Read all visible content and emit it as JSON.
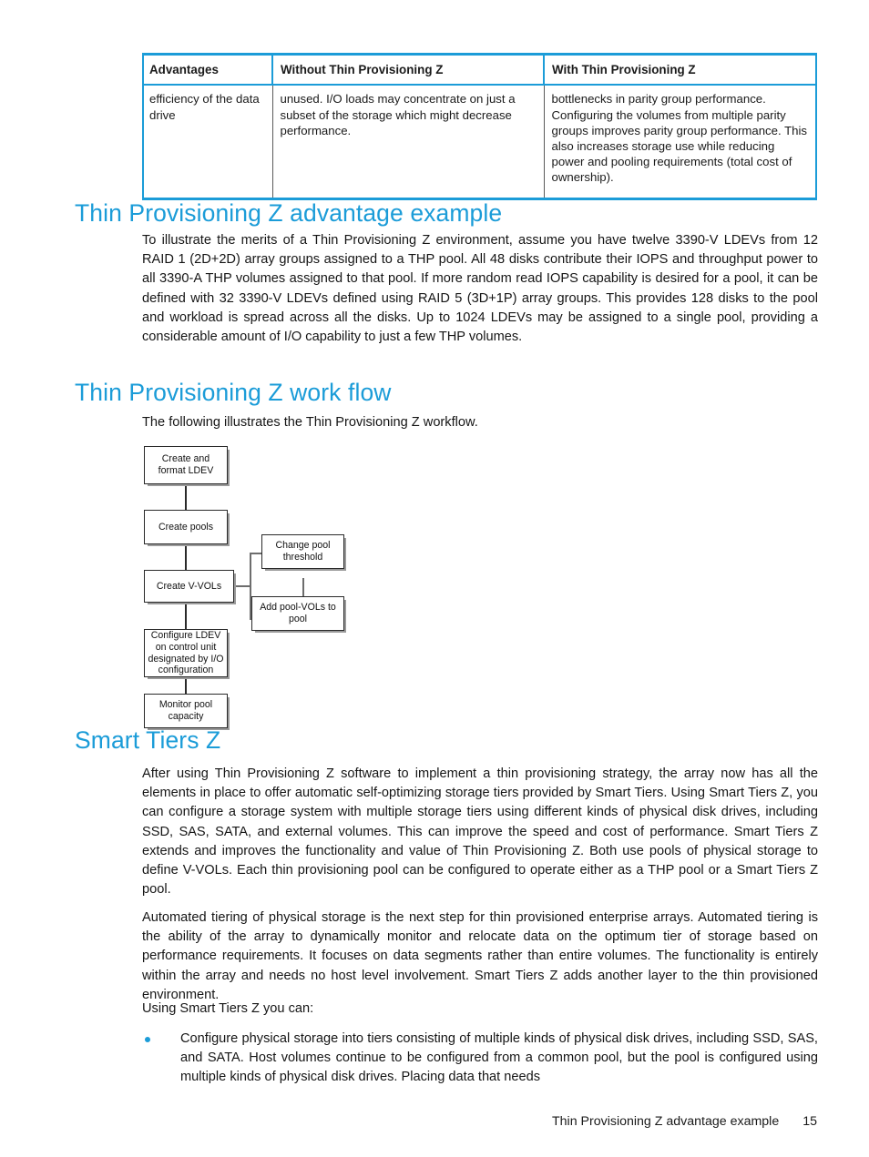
{
  "table": {
    "headers": [
      "Advantages",
      "Without Thin Provisioning Z",
      "With Thin Provisioning Z"
    ],
    "rows": [
      {
        "advantages": "efficiency of the data drive",
        "without": "unused. I/O loads may concentrate on just a subset of the storage which might decrease performance.",
        "with": "bottlenecks in parity group performance. Configuring the volumes from multiple parity groups improves parity group performance. This also increases storage use while reducing power and pooling requirements (total cost of ownership)."
      }
    ]
  },
  "sections": {
    "advantage_example": {
      "heading": "Thin Provisioning Z advantage example",
      "paragraph": "To illustrate the merits of a Thin Provisioning Z environment, assume you have twelve 3390-V LDEVs from 12 RAID 1 (2D+2D) array groups assigned to a THP pool. All 48 disks contribute their IOPS and throughput power to all 3390-A THP volumes assigned to that pool. If more random read IOPS capability is desired for a pool, it can be defined with 32 3390-V LDEVs defined using RAID 5 (3D+1P) array groups. This provides 128 disks to the pool and workload is spread across all the disks. Up to 1024 LDEVs may be assigned to a single pool, providing a considerable amount of I/O capability to just a few THP volumes."
    },
    "work_flow": {
      "heading": "Thin Provisioning Z work flow",
      "paragraph": "The following illustrates the Thin Provisioning Z workflow."
    },
    "smart_tiers": {
      "heading": "Smart Tiers Z",
      "paragraph1": "After using Thin Provisioning Z software to implement a thin provisioning strategy, the array now has all the elements in place to offer automatic self-optimizing storage tiers provided by Smart Tiers. Using Smart Tiers Z, you can configure a storage system with multiple storage tiers using different kinds of physical disk drives, including SSD, SAS, SATA, and external volumes. This can improve the speed and cost of performance. Smart Tiers Z extends and improves the functionality and value of Thin Provisioning Z. Both use pools of physical storage to define V-VOLs. Each thin provisioning pool can be configured to operate either as a THP pool or a Smart Tiers Z pool.",
      "paragraph2": "Automated tiering of physical storage is the next step for thin provisioned enterprise arrays. Automated tiering is the ability of the array to dynamically monitor and relocate data on the optimum tier of storage based on performance requirements. It focuses on data segments rather than entire volumes. The functionality is entirely within the array and needs no host level involvement. Smart Tiers Z adds another layer to the thin provisioned environment.",
      "paragraph3": "Using Smart Tiers Z you can:",
      "bullets": [
        "Configure physical storage into tiers consisting of multiple kinds of physical disk drives, including SSD, SAS, and SATA. Host volumes continue to be configured from a common pool, but the pool is configured using multiple kinds of physical disk drives. Placing data that needs"
      ]
    }
  },
  "diagram": {
    "nodes": [
      {
        "id": "create-format-ldev",
        "label": "Create and format LDEV"
      },
      {
        "id": "create-pools",
        "label": "Create pools"
      },
      {
        "id": "create-vvols",
        "label": "Create V-VOLs"
      },
      {
        "id": "change-pool-threshold",
        "label": "Change pool threshold"
      },
      {
        "id": "add-pool-vols",
        "label": "Add pool-VOLs to pool"
      },
      {
        "id": "configure-ldev",
        "label": "Configure LDEV on control unit designated by I/O configuration"
      },
      {
        "id": "monitor-pool-capacity",
        "label": "Monitor pool capacity"
      }
    ]
  },
  "footer": {
    "running_head": "Thin Provisioning Z advantage example",
    "page_number": "15"
  },
  "colors": {
    "accent": "#1B9CD8",
    "text": "#151515",
    "box_border": "#2a2a2a",
    "box_shadow": "#9a9a9a"
  }
}
